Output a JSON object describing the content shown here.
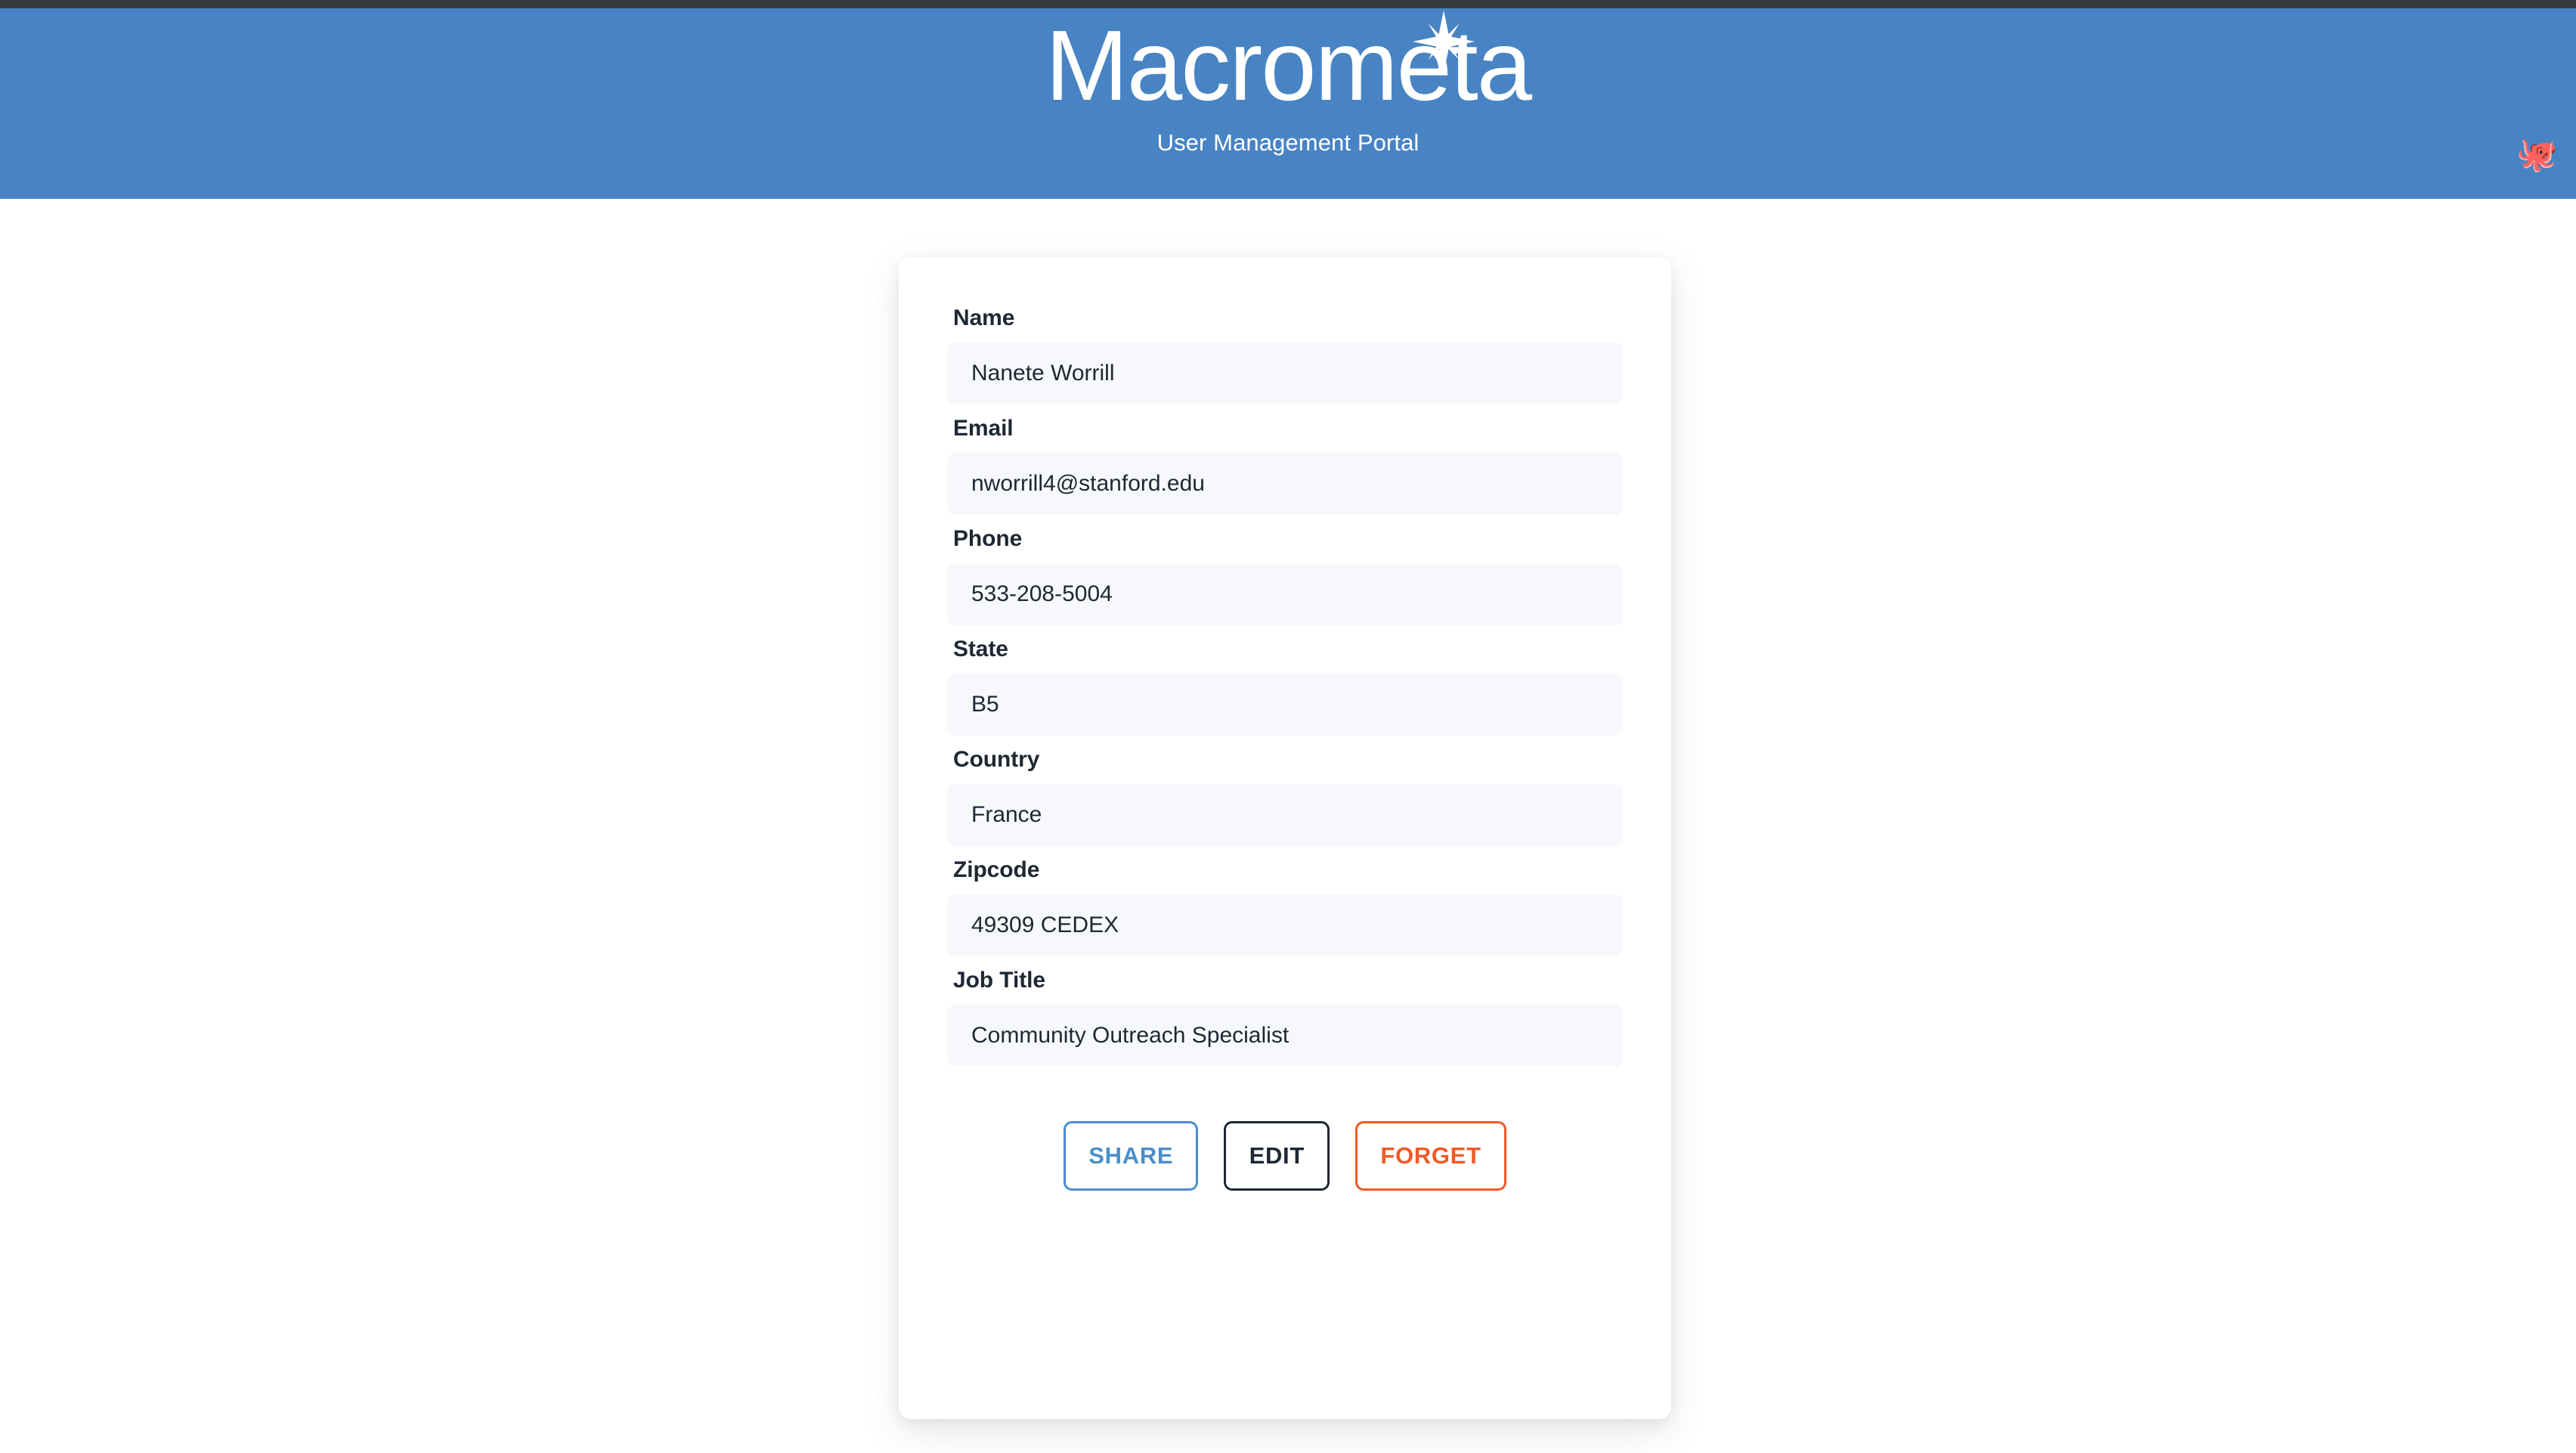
{
  "header": {
    "brand_name": "Macrometa",
    "subtitle": "User Management Portal",
    "account_icon": "🐙",
    "brand_icon": "sparkle-star-icon",
    "background_color": "#4884c4",
    "text_color": "#ffffff"
  },
  "profile": {
    "fields": [
      {
        "label": "Name",
        "value": "Nanete Worrill"
      },
      {
        "label": "Email",
        "value": "nworrill4@stanford.edu"
      },
      {
        "label": "Phone",
        "value": "533-208-5004"
      },
      {
        "label": "State",
        "value": "B5"
      },
      {
        "label": "Country",
        "value": "France"
      },
      {
        "label": "Zipcode",
        "value": "49309 CEDEX"
      },
      {
        "label": "Job Title",
        "value": "Community Outreach Specialist"
      }
    ],
    "actions": [
      {
        "label": "SHARE",
        "color": "#4b8ecb"
      },
      {
        "label": "EDIT",
        "color": "#1f2733"
      },
      {
        "label": "FORGET",
        "color": "#ef5a28"
      }
    ]
  }
}
